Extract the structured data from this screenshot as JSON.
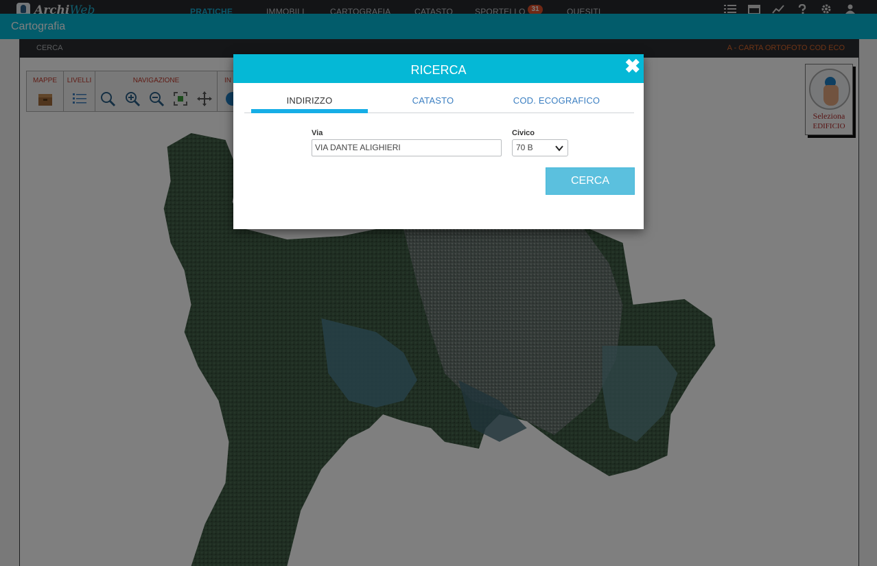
{
  "app": {
    "logo_text_main": "Archi",
    "logo_text_accent": "Web",
    "nav": [
      {
        "label": "PRATICHE",
        "active": true
      },
      {
        "label": "IMMOBILI",
        "active": false
      },
      {
        "label": "CARTOGRAFIA",
        "active": false
      },
      {
        "label": "CATASTO",
        "active": false
      },
      {
        "label": "SPORTELLO",
        "active": false
      },
      {
        "label": "QUESITI",
        "active": false
      }
    ],
    "sportello_badge": "31",
    "top_icons": [
      "list-icon",
      "calendar-icon",
      "chart-icon",
      "help-icon",
      "gear-icon",
      "user-icon"
    ]
  },
  "page": {
    "title": "Cartografia"
  },
  "subbar": {
    "left": "CERCA",
    "right": "A - CARTA ORTOFOTO COD ECO"
  },
  "toolbar": {
    "mappe": "MAPPE",
    "livelli": "LIVELLI",
    "navigazione": "NAVIGAZIONE",
    "info_partial": "IN"
  },
  "select_building": {
    "line1": "Seleziona",
    "line2": "edificio"
  },
  "modal": {
    "title": "RICERCA",
    "close_glyph": "✖",
    "tabs": [
      {
        "label": "INDIRIZZO",
        "active": true
      },
      {
        "label": "CATASTO",
        "active": false
      },
      {
        "label": "COD. ECOGRAFICO",
        "active": false
      }
    ],
    "via_label": "Via",
    "via_value": "VIA DANTE ALIGHIERI",
    "civico_label": "Civico",
    "civico_value": "70 B",
    "search_label": "CERCA"
  },
  "colors": {
    "accent": "#05b8d6",
    "topbar": "#26292d",
    "button": "#5bc0de",
    "badge": "#e0502a"
  }
}
